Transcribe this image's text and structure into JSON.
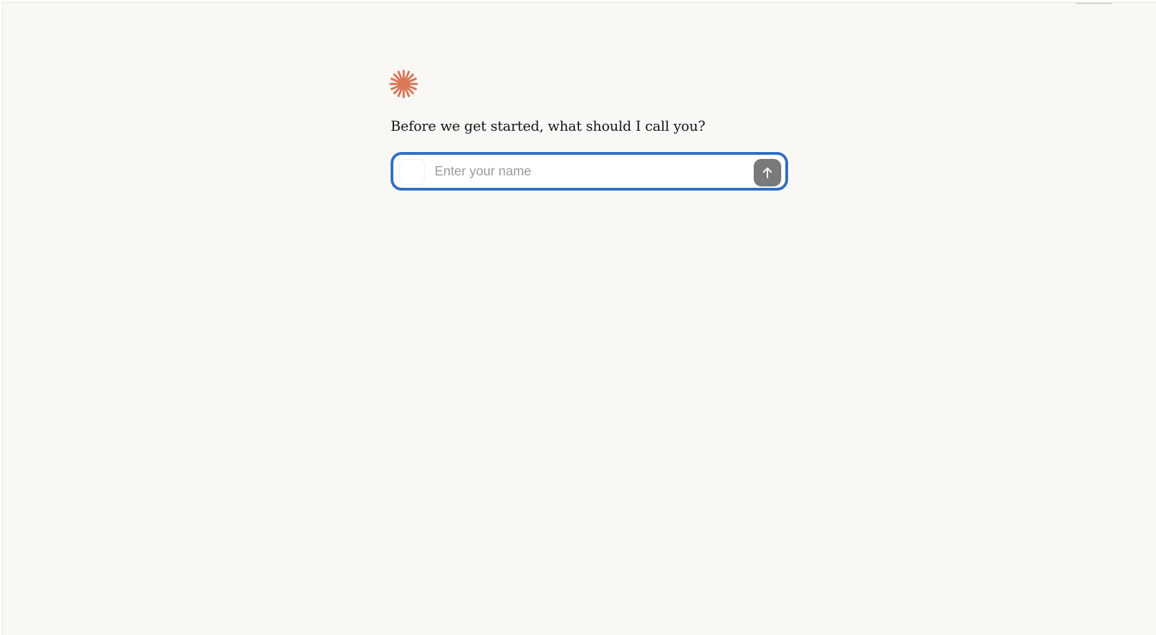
{
  "onboarding": {
    "logo_icon": "sparkle-asterisk-icon",
    "prompt_heading": "Before we get started, what should I call you?",
    "name_input": {
      "value": "",
      "placeholder": "Enter your name"
    },
    "submit_icon": "arrow-up-icon"
  },
  "colors": {
    "page_background": "#f9f8f5",
    "logo_accent": "#d97757",
    "focus_ring": "#2f6fbf",
    "submit_button_disabled": "#7a7a7a"
  }
}
